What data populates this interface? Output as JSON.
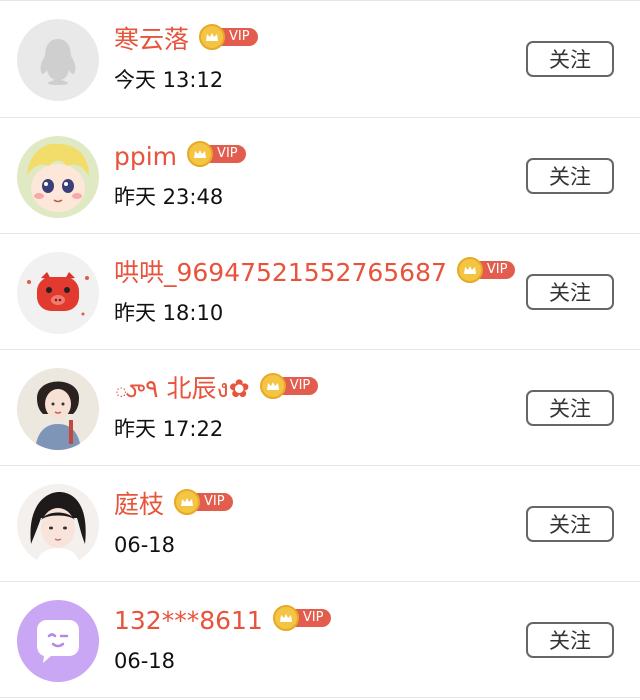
{
  "follow_label": "关注",
  "vip_label": "VIP",
  "colors": {
    "name": "#e8533b",
    "vip_badge": "#e35d4f",
    "crown": "#f4c542"
  },
  "users": [
    {
      "name": "寒云落",
      "time": "今天 13:12",
      "avatar": "default-penguin-avatar"
    },
    {
      "name": "ppim",
      "time": "昨天 23:48",
      "avatar": "cartoon-girl-avatar"
    },
    {
      "name": "哄哄_96947521552765687",
      "time": "昨天 18:10",
      "avatar": "red-pig-avatar"
    },
    {
      "name": "ూ٩ 北辰ง✿",
      "time": "昨天 17:22",
      "avatar": "illustrated-woman-avatar"
    },
    {
      "name": "庭枝",
      "time": "06-18",
      "avatar": "girl-photo-avatar"
    },
    {
      "name": "132***8611",
      "time": "06-18",
      "avatar": "purple-chat-avatar"
    }
  ]
}
